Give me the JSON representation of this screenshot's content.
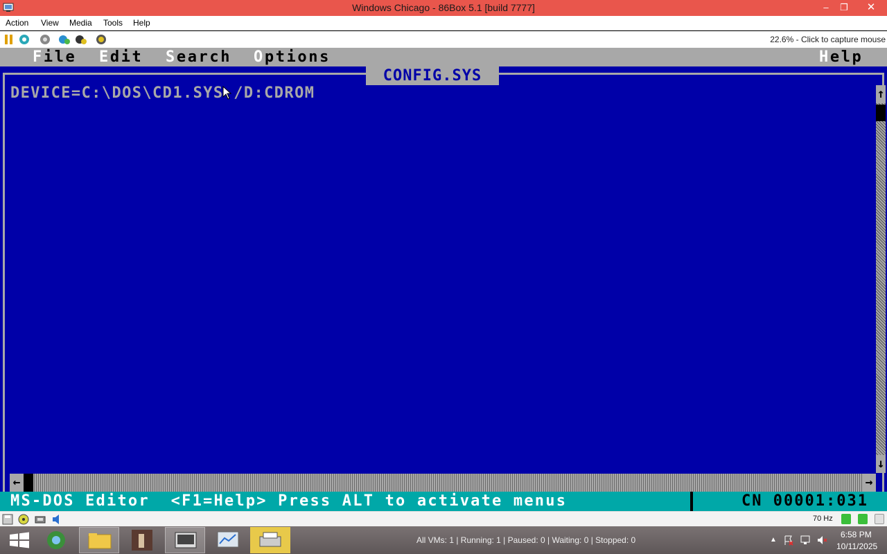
{
  "window": {
    "title": "Windows Chicago - 86Box 5.1 [build 7777]",
    "minimize_glyph": "–",
    "restore_glyph": "❐",
    "close_glyph": "✕",
    "accent": "#e9564c"
  },
  "menubar": {
    "items": [
      "Action",
      "View",
      "Media",
      "Tools",
      "Help"
    ]
  },
  "toolbar": {
    "icons": [
      "pause-icon",
      "reset-icon",
      "ctrl-alt-del-icon",
      "settings-icon",
      "screenshot-icon",
      "power-icon"
    ],
    "capture_text": "22.6% - Click to capture mouse"
  },
  "dos": {
    "menus": [
      {
        "hot": "F",
        "rest": "ile"
      },
      {
        "hot": "E",
        "rest": "dit"
      },
      {
        "hot": "S",
        "rest": "earch"
      },
      {
        "hot": "O",
        "rest": "ptions"
      },
      {
        "hot": "H",
        "rest": "elp"
      }
    ],
    "doc_title": "CONFIG.SYS",
    "lines": [
      "DEVICE=C:\\DOS\\CD1.SYS /D:CDROM"
    ],
    "scroll_up_glyph": "↑",
    "scroll_down_glyph": "↓",
    "scroll_left_glyph": "←",
    "scroll_right_glyph": "→",
    "status_message": "MS-DOS Editor  <F1=Help> Press ALT to activate menus",
    "cursor_position": "CN 00001:031",
    "colors": {
      "background": "#0000a8",
      "menu": "#a8a8a8",
      "status": "#00a8a8"
    }
  },
  "statusbar": {
    "icons": [
      "floppy-icon",
      "cdrom-icon",
      "network-icon",
      "sound-icon"
    ],
    "refresh_rate": "70 Hz"
  },
  "taskbar": {
    "apps": [
      "start-button",
      "browser",
      "file-explorer",
      "app-figure",
      "86box-manager",
      "resource-monitor",
      "printer"
    ],
    "vm_summary": "All VMs: 1 | Running: 1 | Paused: 0 | Waiting: 0 | Stopped: 0",
    "tray_chevron": "▲",
    "time": "6:58 PM",
    "date": "10/11/2025"
  }
}
